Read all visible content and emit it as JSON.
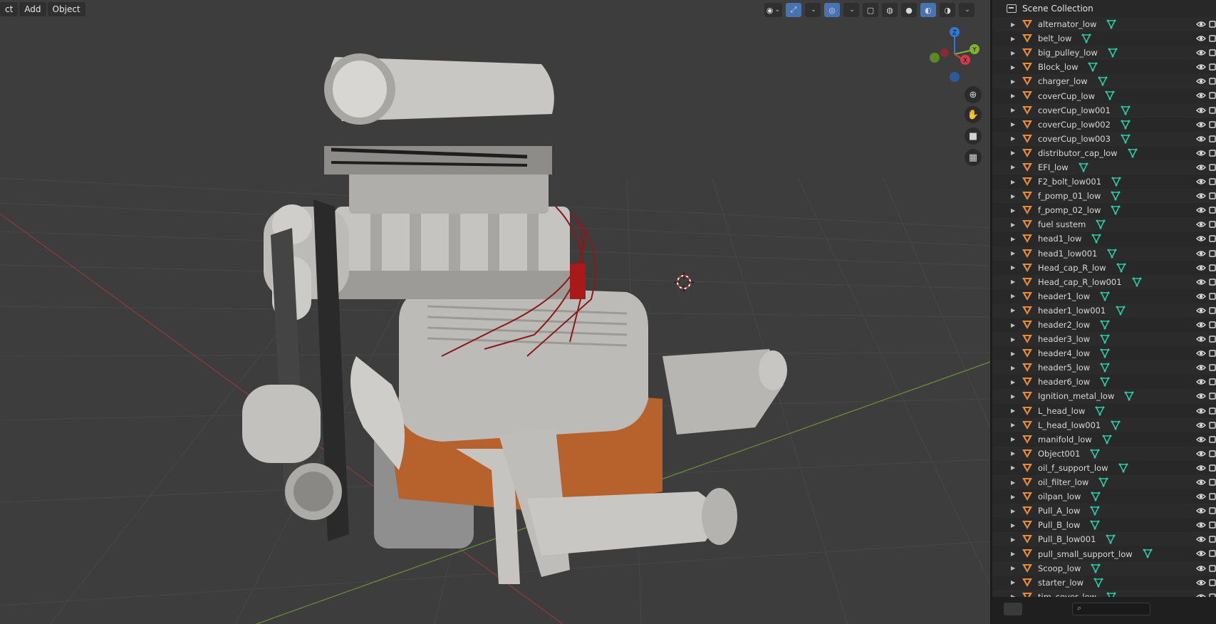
{
  "viewport": {
    "menu": [
      "ct",
      "Add",
      "Object"
    ],
    "tools": [
      "view-overlay",
      "transform",
      "gizmo",
      "xray",
      "wireframe",
      "solid",
      "material",
      "rendered"
    ]
  },
  "gizmo": {
    "x": "X",
    "y": "Y",
    "z": "Z"
  },
  "outliner": {
    "title": "Scene Collection",
    "items": [
      "alternator_low",
      "belt_low",
      "big_pulley_low",
      "Block_low",
      "charger_low",
      "coverCup_low",
      "coverCup_low001",
      "coverCup_low002",
      "coverCup_low003",
      "distributor_cap_low",
      "EFI_low",
      "F2_bolt_low001",
      "f_pomp_01_low",
      "f_pomp_02_low",
      "fuel sustem",
      "head1_low",
      "head1_low001",
      "Head_cap_R_low",
      "Head_cap_R_low001",
      "header1_low",
      "header1_low001",
      "header2_low",
      "header3_low",
      "header4_low",
      "header5_low",
      "header6_low",
      "Ignition_metal_low",
      "L_head_low",
      "L_head_low001",
      "manifold_low",
      "Object001",
      "oil_f_support_low",
      "oil_filter_low",
      "oilpan_low",
      "Pull_A_low",
      "Pull_B_low",
      "Pull_B_low001",
      "pull_small_support_low",
      "Scoop_low",
      "starter_low",
      "tim_cover_low"
    ],
    "search_icon": "search-icon"
  },
  "colors": {
    "accent": "#4772b3",
    "mesh": "#e68a3c",
    "data": "#2fc7a4",
    "bg": "#3d3d3d"
  }
}
